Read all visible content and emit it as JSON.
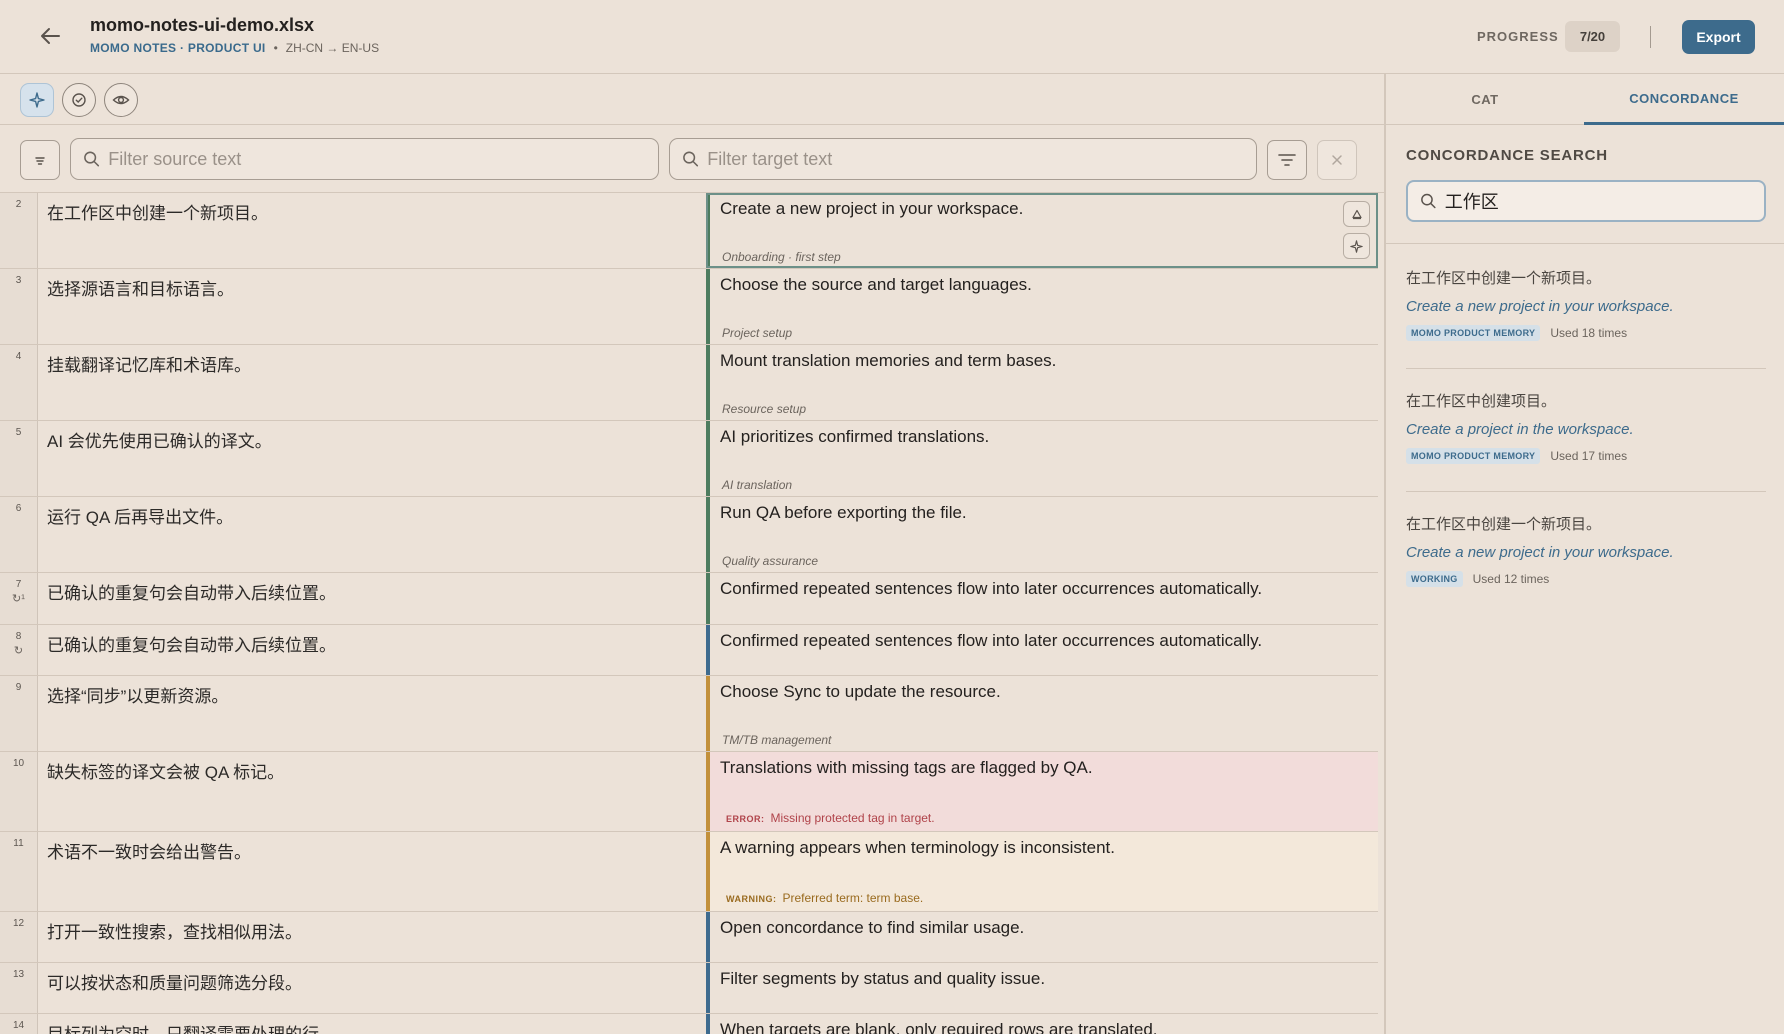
{
  "header": {
    "file_title": "momo-notes-ui-demo.xlsx",
    "project": "MOMO NOTES · PRODUCT UI",
    "dot": "•",
    "lang_pair": "ZH-CN → EN-US",
    "progress_label": "PROGRESS",
    "progress_value": "7/20",
    "export_label": "Export"
  },
  "toolbar": {
    "icons": [
      "sparkle-icon",
      "check-circle-icon",
      "eye-icon"
    ]
  },
  "filters": {
    "source_placeholder": "Filter source text",
    "target_placeholder": "Filter target text"
  },
  "rows": [
    {
      "num": "2",
      "source": "在工作区中创建一个新项目。",
      "target": "Create a new project in your workspace.",
      "note": "Onboarding · first step",
      "status": "confirmed"
    },
    {
      "num": "3",
      "source": "选择源语言和目标语言。",
      "target": "Choose the source and target languages.",
      "note": "Project setup",
      "status": "confirmed"
    },
    {
      "num": "4",
      "source": "挂载翻译记忆库和术语库。",
      "target": "Mount translation memories and term bases.",
      "note": "Resource setup",
      "status": "confirmed"
    },
    {
      "num": "5",
      "source": "AI 会优先使用已确认的译文。",
      "target": "AI prioritizes confirmed translations.",
      "note": "AI translation",
      "status": "confirmed"
    },
    {
      "num": "6",
      "source": "运行 QA 后再导出文件。",
      "target": "Run QA before exporting the file.",
      "note": "Quality assurance",
      "status": "confirmed"
    },
    {
      "num": "7",
      "repeat": "↻¹",
      "source": "已确认的重复句会自动带入后续位置。",
      "target": "Confirmed repeated sentences flow into later occurrences automatically.",
      "note": "",
      "status": "confirmed"
    },
    {
      "num": "8",
      "repeat": "↻",
      "source": "已确认的重复句会自动带入后续位置。",
      "target": "Confirmed repeated sentences flow into later occurrences automatically.",
      "note": "",
      "status": "draft"
    },
    {
      "num": "9",
      "source": "选择“同步”以更新资源。",
      "target": "Choose Sync to update the resource.",
      "note": "TM/TB management",
      "status": "amber"
    },
    {
      "num": "10",
      "source": "缺失标签的译文会被 QA 标记。",
      "target": "Translations with missing tags are flagged by QA.",
      "issue_tag": "ERROR:",
      "issue_text": "Missing protected tag in target.",
      "status": "error"
    },
    {
      "num": "11",
      "source": "术语不一致时会给出警告。",
      "target": "A warning appears when terminology is inconsistent.",
      "issue_tag": "WARNING:",
      "issue_text": "Preferred term: term base.",
      "status": "warning"
    },
    {
      "num": "12",
      "source": "打开一致性搜索，查找相似用法。",
      "target": "Open concordance to find similar usage.",
      "note": "",
      "status": "draft"
    },
    {
      "num": "13",
      "source": "可以按状态和质量问题筛选分段。",
      "target": "Filter segments by status and quality issue.",
      "note": "",
      "status": "draft"
    },
    {
      "num": "14",
      "source": "目标列为空时，只翻译需要处理的行。",
      "target": "When targets are blank, only required rows are translated.",
      "note": "",
      "status": "draft"
    }
  ],
  "panel": {
    "tab_cat": "CAT",
    "tab_concordance": "CONCORDANCE",
    "heading": "CONCORDANCE SEARCH",
    "query": "工作区",
    "results": [
      {
        "source": "在工作区中创建一个新项目。",
        "target": "Create a new project in your workspace.",
        "badge": "MOMO PRODUCT MEMORY",
        "used": "Used 18 times"
      },
      {
        "source": "在工作区中创建项目。",
        "target": "Create a project in the workspace.",
        "badge": "MOMO PRODUCT MEMORY",
        "used": "Used 17 times"
      },
      {
        "source": "在工作区中创建一个新项目。",
        "target": "Create a new project in your workspace.",
        "badge": "WORKING",
        "used": "Used 12 times"
      }
    ]
  },
  "colors": {
    "accent": "#3d6b8c",
    "confirmed": "#4d7c5f",
    "amber": "#c2903b",
    "draft": "#3e6b8e",
    "error": "#b0434a",
    "warning": "#9a6b1f"
  }
}
